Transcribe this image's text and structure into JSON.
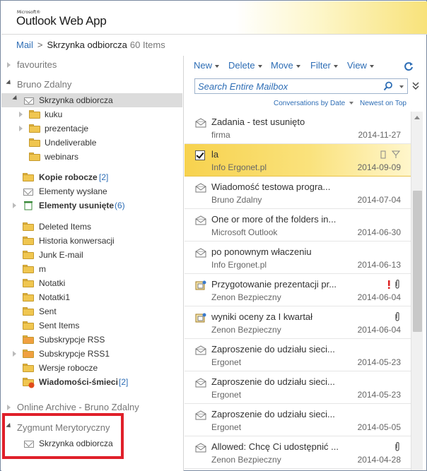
{
  "app": {
    "logo_small": "Microsoft®",
    "logo": "Outlook Web App"
  },
  "breadcrumb": {
    "mail": "Mail",
    "separator": ">",
    "folder": "Skrzynka odbiorcza",
    "count": "60 Items"
  },
  "nav": {
    "favourites": "favourites",
    "account": "Bruno Zdalny",
    "inbox": "Skrzynka odbiorcza",
    "subfolders": [
      "kuku",
      "prezentacje",
      "Undeliverable",
      "webinars"
    ],
    "drafts": {
      "label": "Kopie robocze",
      "count": "[2]"
    },
    "sent_items": "Elementy wysłane",
    "deleted": {
      "label": "Elementy usunięte",
      "count": "(6)"
    },
    "folders": [
      "Deleted Items",
      "Historia konwersacji",
      "Junk E-mail",
      "m",
      "Notatki",
      "Notatki1",
      "Sent",
      "Sent Items",
      "Subskrypcje RSS",
      "Subskrypcje RSS1",
      "Wersje robocze"
    ],
    "junk": {
      "label": "Wiadomości-śmieci",
      "count": "[2]"
    },
    "archive": "Online Archive - Bruno Zdalny",
    "shared_account": "Zygmunt Merytoryczny",
    "shared_inbox": "Skrzynka odbiorcza"
  },
  "toolbar": {
    "new": "New",
    "delete": "Delete",
    "move": "Move",
    "filter": "Filter",
    "view": "View"
  },
  "search": {
    "placeholder": "Search Entire Mailbox"
  },
  "sort": {
    "conversations": "Conversations by Date",
    "order": "Newest on Top"
  },
  "messages": [
    {
      "subject": "Zadania - test usunięto",
      "from": "firma",
      "date": "2014-11-27"
    },
    {
      "subject": "la",
      "from": "Info Ergonet.pl",
      "date": "2014-09-09"
    },
    {
      "subject": "Wiadomość testowa progra...",
      "from": "Bruno Zdalny",
      "date": "2014-07-04"
    },
    {
      "subject": "One or more of the folders in...",
      "from": "Microsoft Outlook",
      "date": "2014-06-30"
    },
    {
      "subject": "po ponownym właczeniu",
      "from": "Info Ergonet.pl",
      "date": "2014-06-13"
    },
    {
      "subject": "Przygotowanie prezentacji pr...",
      "from": "Zenon Bezpieczny",
      "date": "2014-06-04"
    },
    {
      "subject": "wyniki oceny za I kwartał",
      "from": "Zenon Bezpieczny",
      "date": "2014-06-04"
    },
    {
      "subject": "Zaproszenie do udziału sieci...",
      "from": "Ergonet",
      "date": "2014-05-23"
    },
    {
      "subject": "Zaproszenie do udziału sieci...",
      "from": "Ergonet",
      "date": "2014-05-23"
    },
    {
      "subject": "Zaproszenie do udziału sieci...",
      "from": "Ergonet",
      "date": "2014-05-05"
    },
    {
      "subject": "Allowed: Chcę Ci udostępnić ...",
      "from": "Zenon Bezpieczny",
      "date": "2014-04-28"
    }
  ],
  "colors": {
    "accent": "#2d6db5",
    "selection": "#f7d24e",
    "highlight_box": "#e0202a"
  }
}
